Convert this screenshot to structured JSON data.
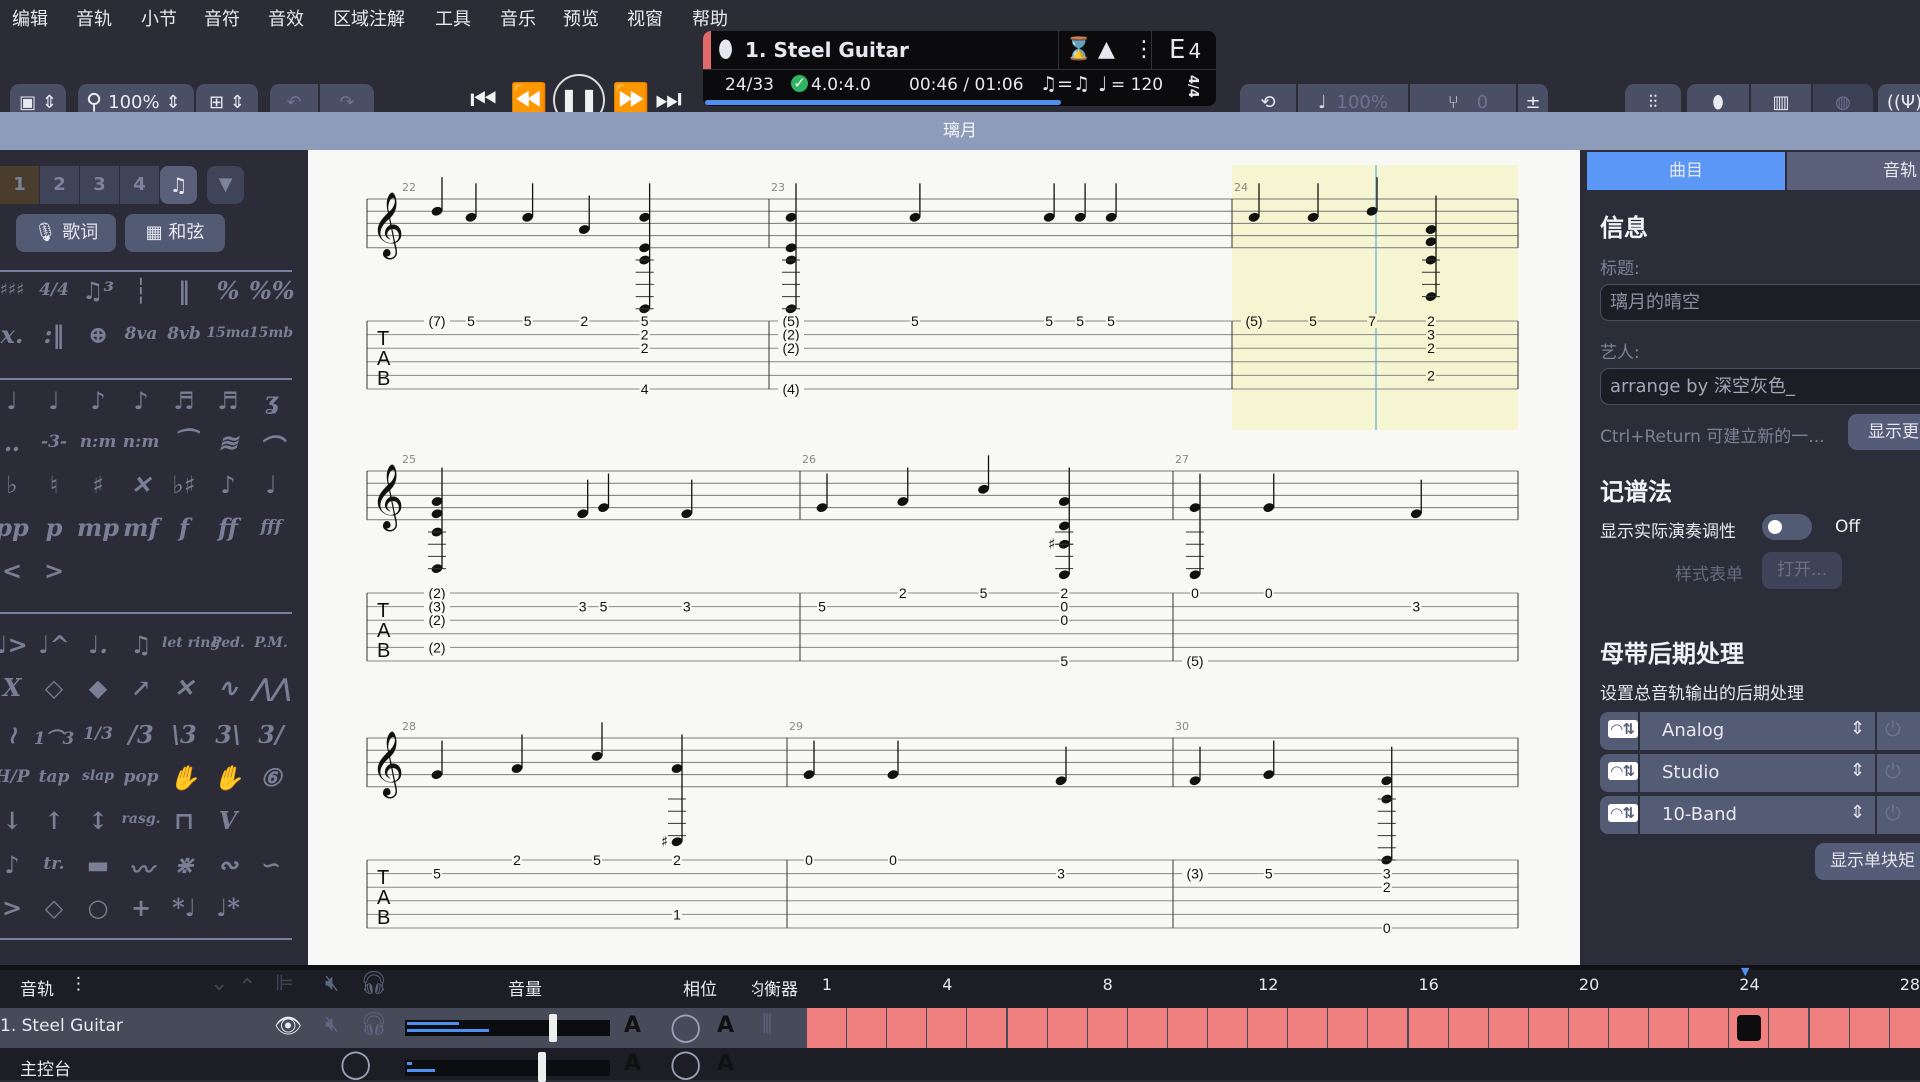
{
  "menu": [
    "编辑",
    "音轨",
    "小节",
    "音符",
    "音效",
    "区域注解",
    "工具",
    "音乐",
    "预览",
    "视窗",
    "帮助"
  ],
  "toolbar": {
    "zoom": "100%",
    "transport_icons": [
      "skip-start-icon",
      "rewind-icon",
      "pause-icon",
      "fast-forward-icon",
      "skip-end-icon"
    ],
    "lcd": {
      "track_name": "1. Steel Guitar",
      "key": "E",
      "key_sub": "4",
      "bar_position": "24/33",
      "time_signature_check": "4.0:4.0",
      "time": "00:46 / 01:06",
      "swing": "♫=♫",
      "tempo": "= 120",
      "time_sig": "4/4",
      "progress": 0.7,
      "track_color": "#e06a6a"
    },
    "playback_speed": "100%",
    "transpose": "0"
  },
  "title_bar": "璃月",
  "palette": {
    "voices": [
      "1",
      "2",
      "3",
      "4"
    ],
    "lyrics_button": "歌词",
    "chord_button": "和弦",
    "rows": [
      [
        "♯♯♯",
        "4/4",
        "♫³",
        "┆",
        "‖",
        "%",
        "%%"
      ],
      [
        "x.",
        ":‖",
        "⊕",
        "8va",
        "8vb",
        "15ma",
        "15mb"
      ],
      [
        "♩",
        "♩",
        "♪",
        "♪",
        "♬",
        "♬",
        "ʓ"
      ],
      [
        "‥",
        "-3-",
        "n:m",
        "n:m",
        "⁀",
        "≋",
        "⌒"
      ],
      [
        "♭",
        "♮",
        "♯",
        "✕",
        "♭♯",
        "♪",
        "♩"
      ],
      [
        "pp",
        "p",
        "mp",
        "mf",
        "f",
        "ff",
        "fff"
      ],
      [
        "<",
        ">"
      ],
      [
        "♩>",
        "♩^",
        "♩.",
        "♫",
        "let ring",
        "Ped.",
        "P.M."
      ],
      [
        "X",
        "◇",
        "◆",
        "↗",
        "✕",
        "∿",
        "⋀⋀"
      ],
      [
        "≀",
        "1⌒3",
        "1/3",
        "/3",
        "\\3",
        "3\\",
        "3/"
      ],
      [
        "H/P",
        "tap",
        "slap",
        "pop",
        "✋",
        "✋",
        "⑥"
      ],
      [
        "↓",
        "↑",
        "↕",
        "rasg.",
        "⊓",
        "V"
      ],
      [
        "♪",
        "tr.",
        "▬",
        "〰",
        "⋇",
        "∾",
        "∽"
      ],
      [
        ">",
        "◇",
        "○",
        "+",
        "*♩",
        "♩*"
      ]
    ]
  },
  "score": {
    "tab_label": [
      "T",
      "A",
      "B"
    ],
    "tuning": "E4",
    "highlight_color": "#f6f5d2",
    "systems": [
      {
        "measures": [
          {
            "number": "22",
            "notes": [
              {
                "b": 0,
                "s": 1,
                "f": "7",
                "p": true
              },
              {
                "b": 0.45,
                "s": 1,
                "f": "5"
              },
              {
                "b": 1.2,
                "s": 1,
                "f": "5"
              },
              {
                "b": 1.95,
                "s": 1,
                "f": "2"
              },
              {
                "b": 2.75,
                "s": 1,
                "f": "5"
              },
              {
                "b": 2.75,
                "s": 2,
                "f": "2"
              },
              {
                "b": 2.75,
                "s": 3,
                "f": "2"
              },
              {
                "b": 2.75,
                "s": 6,
                "f": "4"
              }
            ]
          },
          {
            "number": "23",
            "notes": [
              {
                "b": 0,
                "s": 1,
                "f": "5",
                "p": true
              },
              {
                "b": 0,
                "s": 2,
                "f": "2",
                "p": true
              },
              {
                "b": 0,
                "s": 3,
                "f": "2",
                "p": true
              },
              {
                "b": 0,
                "s": 6,
                "f": "4",
                "p": true
              },
              {
                "b": 1.2,
                "s": 1,
                "f": "5"
              },
              {
                "b": 2.5,
                "s": 1,
                "f": "5"
              },
              {
                "b": 2.8,
                "s": 1,
                "f": "5"
              },
              {
                "b": 3.1,
                "s": 1,
                "f": "5"
              }
            ]
          },
          {
            "number": "24",
            "notes": [
              {
                "b": 0,
                "s": 1,
                "f": "5",
                "p": true
              },
              {
                "b": 1,
                "s": 1,
                "f": "5"
              },
              {
                "b": 2,
                "s": 1,
                "f": "7"
              },
              {
                "b": 3,
                "s": 1,
                "f": "2"
              },
              {
                "b": 3,
                "s": 2,
                "f": "3"
              },
              {
                "b": 3,
                "s": 3,
                "f": "2"
              },
              {
                "b": 3,
                "s": 5,
                "f": "2"
              }
            ]
          }
        ]
      },
      {
        "measures": [
          {
            "number": "25",
            "notes": [
              {
                "b": 0,
                "s": 1,
                "f": "2",
                "p": true
              },
              {
                "b": 0,
                "s": 2,
                "f": "3",
                "p": true
              },
              {
                "b": 0,
                "s": 3,
                "f": "2",
                "p": true
              },
              {
                "b": 0,
                "s": 5,
                "f": "2",
                "p": true
              },
              {
                "b": 1.75,
                "s": 2,
                "f": "3"
              },
              {
                "b": 2,
                "s": 2,
                "f": "5"
              },
              {
                "b": 3,
                "s": 2,
                "f": "3"
              }
            ]
          },
          {
            "number": "26",
            "notes": [
              {
                "b": 0,
                "s": 2,
                "f": "5"
              },
              {
                "b": 1,
                "s": 1,
                "f": "2"
              },
              {
                "b": 2,
                "s": 1,
                "f": "5"
              },
              {
                "b": 3,
                "s": 1,
                "f": "2"
              },
              {
                "b": 3,
                "s": 2,
                "f": "0"
              },
              {
                "b": 3,
                "s": 3,
                "f": "0"
              },
              {
                "b": 3,
                "s": 6,
                "f": "5"
              }
            ]
          },
          {
            "number": "27",
            "notes": [
              {
                "b": 0,
                "s": 1,
                "f": "0"
              },
              {
                "b": 0,
                "s": 6,
                "f": "5",
                "p": true
              },
              {
                "b": 1,
                "s": 1,
                "f": "0"
              },
              {
                "b": 3,
                "s": 2,
                "f": "3"
              }
            ]
          }
        ]
      },
      {
        "measures": [
          {
            "number": "28",
            "notes": [
              {
                "b": 0,
                "s": 2,
                "f": "5"
              },
              {
                "b": 1,
                "s": 1,
                "f": "2"
              },
              {
                "b": 2,
                "s": 1,
                "f": "5"
              },
              {
                "b": 3,
                "s": 1,
                "f": "2"
              },
              {
                "b": 3,
                "s": 5,
                "f": "1"
              }
            ]
          },
          {
            "number": "29",
            "notes": [
              {
                "b": 0,
                "s": 1,
                "f": "0"
              },
              {
                "b": 1,
                "s": 1,
                "f": "0"
              },
              {
                "b": 3,
                "s": 2,
                "f": "3"
              }
            ]
          },
          {
            "number": "30",
            "notes": [
              {
                "b": 0,
                "s": 2,
                "f": "3",
                "p": true
              },
              {
                "b": 1,
                "s": 2,
                "f": "5"
              },
              {
                "b": 2.6,
                "s": 2,
                "f": "3"
              },
              {
                "b": 2.6,
                "s": 3,
                "f": "2"
              },
              {
                "b": 2.6,
                "s": 6,
                "f": "0"
              }
            ]
          }
        ]
      }
    ]
  },
  "right_panel": {
    "tabs": [
      "曲目",
      "音轨"
    ],
    "info_heading": "信息",
    "title_label": "标题:",
    "title_value": "璃月的晴空",
    "artist_label": "艺人:",
    "artist_value": "arrange by 深空灰色_",
    "hint": "Ctrl+Return 可建立新的一...",
    "show_more": "显示更",
    "notation_heading": "记谱法",
    "transpose_label": "显示实际演奏调性",
    "transpose_state": "Off",
    "stylesheet_label": "样式表单",
    "open_button": "打开...",
    "mastering_heading": "母带后期处理",
    "mastering_desc": "设置总音轨输出的后期处理",
    "effects": [
      "Analog",
      "Studio",
      "10-Band"
    ],
    "show_single": "显示单块矩"
  },
  "bottom": {
    "tracks_label": "音轨",
    "volume_label": "音量",
    "pan_label": "相位",
    "eq_label": "均衡器",
    "ruler": [
      "1",
      "4",
      "8",
      "12",
      "16",
      "20",
      "24",
      "28"
    ],
    "current_bar": 24,
    "bars_visible": 28,
    "track": {
      "name": "1. Steel Guitar",
      "volume": 0.7,
      "color": "#f08080"
    },
    "master": {
      "name": "主控台",
      "volume": 0.65
    }
  }
}
